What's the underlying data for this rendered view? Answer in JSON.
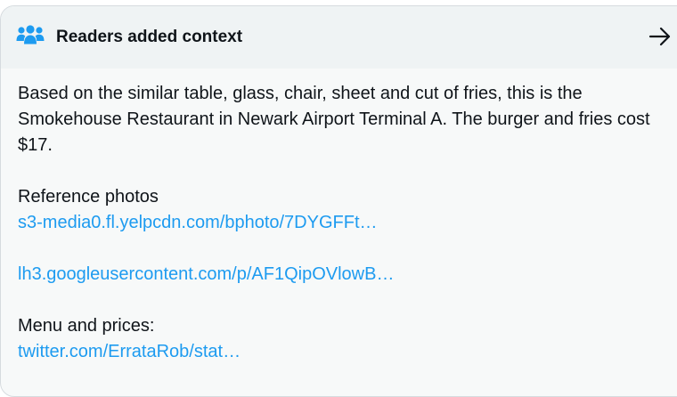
{
  "header": {
    "title": "Readers added context",
    "icon": "people-icon",
    "action_icon": "arrow-right-icon"
  },
  "context": {
    "text": "Based on the similar table, glass, chair, sheet and cut of fries, this is the Smokehouse Restaurant in Newark Airport Terminal A. The burger and fries cost $17.",
    "reference_label": "Reference photos",
    "links": [
      "s3-media0.fl.yelpcdn.com/bphoto/7DYGFFt…",
      "lh3.googleusercontent.com/p/AF1QipOVlowB…"
    ],
    "menu_label": "Menu and prices:",
    "menu_link": "twitter.com/ErrataRob/stat…"
  },
  "colors": {
    "header_bg": "#eff3f4",
    "card_bg": "#f7f9f9",
    "text": "#0f1419",
    "link": "#1d9bf0",
    "icon": "#1d9bf0"
  }
}
